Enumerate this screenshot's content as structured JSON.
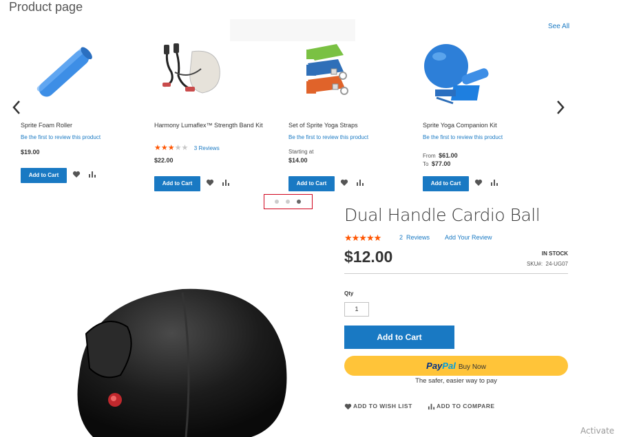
{
  "page": {
    "heading": "Product page",
    "see_all": "See All"
  },
  "carousel": {
    "products": [
      {
        "name": "Sprite Foam Roller",
        "review_text": "Be the first to review this product",
        "price": "$19.00",
        "add_to_cart": "Add to Cart"
      },
      {
        "name": "Harmony Lumaflex™ Strength Band Kit",
        "rating_stars": 3,
        "rating_max": 5,
        "reviews_count": "3",
        "reviews_label": "Reviews",
        "price": "$22.00",
        "add_to_cart": "Add to Cart"
      },
      {
        "name": "Set of Sprite Yoga Straps",
        "review_text": "Be the first to review this product",
        "price_label": "Starting at",
        "price": "$14.00",
        "add_to_cart": "Add to Cart"
      },
      {
        "name": "Sprite Yoga Companion Kit",
        "review_text": "Be the first to review this product",
        "from_label": "From",
        "price_from": "$61.00",
        "to_label": "To",
        "price_to": "$77.00",
        "add_to_cart": "Add to Cart"
      }
    ],
    "dots": 3,
    "active_dot": 3
  },
  "product": {
    "title": "Dual Handle Cardio Ball",
    "rating_stars": 5,
    "reviews_count": "2",
    "reviews_label": "Reviews",
    "add_review": "Add Your Review",
    "price": "$12.00",
    "stock": "IN STOCK",
    "sku_label": "SKU#:",
    "sku": "24-UG07",
    "qty_label": "Qty",
    "qty_value": "1",
    "add_to_cart": "Add to Cart",
    "paypal_text_1": "Pay",
    "paypal_text_2": "Pal",
    "paypal_buy": "Buy Now",
    "paypal_tagline": "The safer, easier way to pay",
    "wishlist": "ADD TO WISH LIST",
    "compare": "ADD TO COMPARE"
  },
  "watermark": "Activate Win",
  "colors": {
    "accent": "#1979c3",
    "star": "#ff5501",
    "paypal": "#ffc439",
    "highlight_border": "#d0021b"
  }
}
